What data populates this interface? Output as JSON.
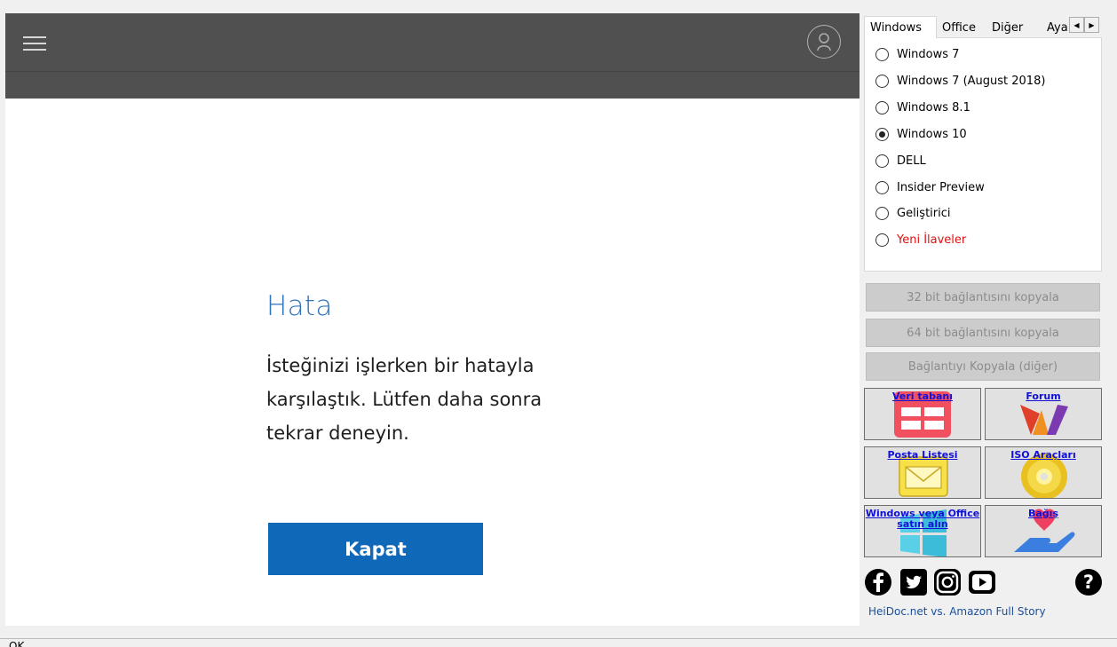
{
  "web": {
    "error_title": "Hata",
    "error_message": "İsteğinizi işlerken bir hatayla karşılaştık. Lütfen daha sonra tekrar deneyin.",
    "close_button": "Kapat"
  },
  "tabs": [
    {
      "label": "Windows",
      "active": true
    },
    {
      "label": "Office",
      "active": false
    },
    {
      "label": "Diğer",
      "active": false
    },
    {
      "label": "Aya",
      "active": false
    }
  ],
  "options": [
    {
      "label": "Windows 7",
      "checked": false,
      "color": "#000000"
    },
    {
      "label": "Windows 7 (August 2018)",
      "checked": false,
      "color": "#000000"
    },
    {
      "label": "Windows 8.1",
      "checked": false,
      "color": "#000000"
    },
    {
      "label": "Windows 10",
      "checked": true,
      "color": "#000000"
    },
    {
      "label": "DELL",
      "checked": false,
      "color": "#000000"
    },
    {
      "label": "Insider Preview",
      "checked": false,
      "color": "#000000"
    },
    {
      "label": "Geliştirici",
      "checked": false,
      "color": "#000000"
    },
    {
      "label": "Yeni İlaveler",
      "checked": false,
      "color": "#e01010"
    }
  ],
  "buttons": {
    "copy_32": "32 bit bağlantısını kopyala",
    "copy_64": "64 bit bağlantısını kopyala",
    "copy_other": "Bağlantıyı Kopyala (diğer)"
  },
  "tiles": {
    "database": "Veri tabanı",
    "forum": "Forum",
    "mailing": "Posta Listesi",
    "iso": "ISO Araçları",
    "buy": "Windows veya Office satın alın",
    "donate": "Bağış"
  },
  "footer": {
    "story_link": "HeiDoc.net vs. Amazon Full Story",
    "help_glyph": "?"
  },
  "status": {
    "text": "OK"
  },
  "colors": {
    "header": "#505050",
    "accent": "#0f68b8",
    "title": "#2f73b8",
    "link": "#1010d8"
  }
}
